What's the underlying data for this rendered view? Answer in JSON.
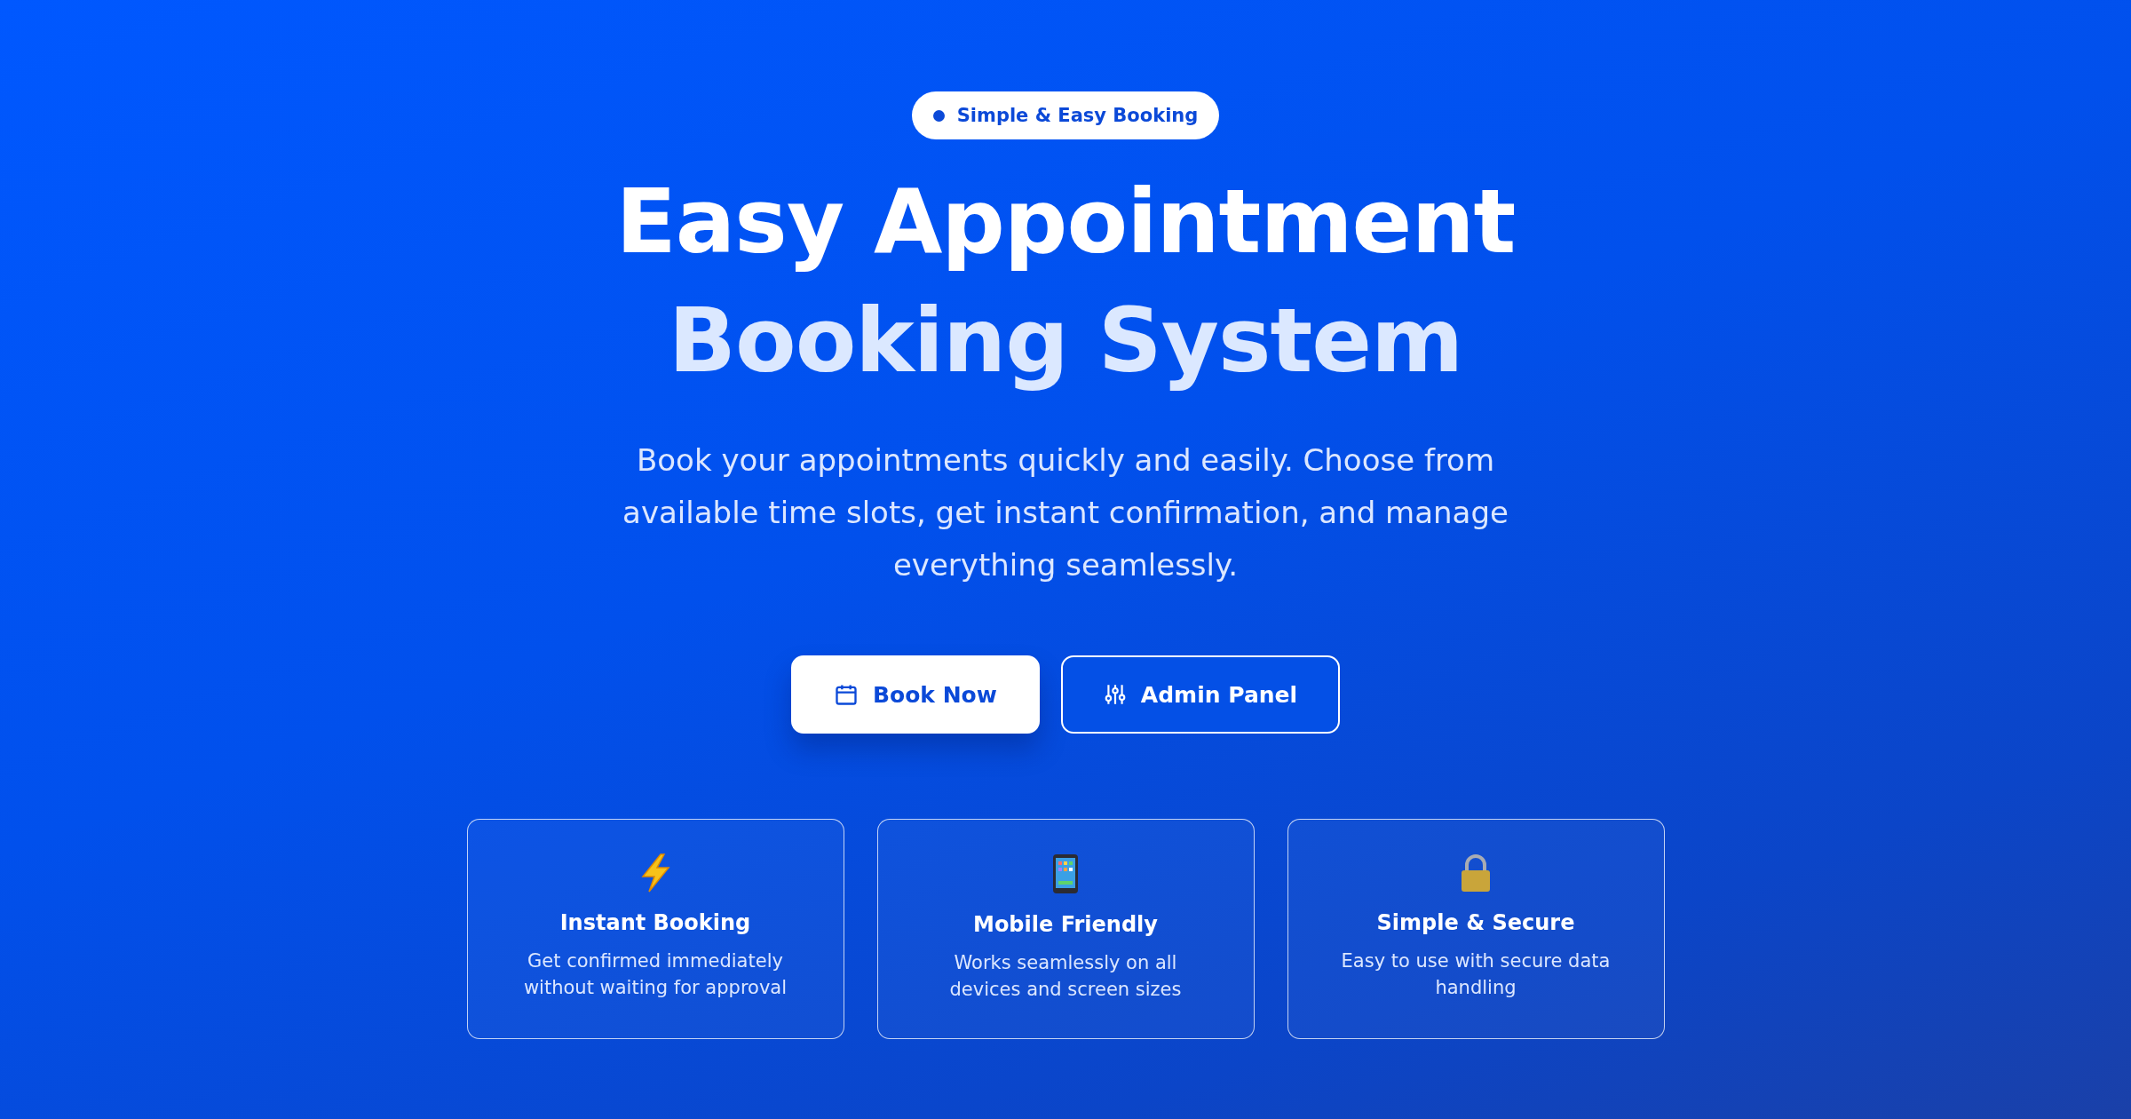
{
  "badge": {
    "label": "Simple & Easy Booking"
  },
  "title": {
    "line_1": "Easy Appointment",
    "line_2": "Booking System"
  },
  "description": "Book your appointments quickly and easily. Choose from available time slots, get instant confirmation, and manage everything seamlessly.",
  "buttons": [
    {
      "label": "Book Now",
      "kind": "primary"
    },
    {
      "label": "Admin Panel",
      "kind": "outline"
    }
  ],
  "features": [
    {
      "kind": "bolt",
      "title": "Instant Booking",
      "text": "Get confirmed immediately without waiting for approval"
    },
    {
      "kind": "phone",
      "title": "Mobile Friendly",
      "text": "Works seamlessly on all devices and screen sizes"
    },
    {
      "kind": "lock",
      "title": "Simple & Secure",
      "text": "Easy to use with secure data handling"
    }
  ]
}
